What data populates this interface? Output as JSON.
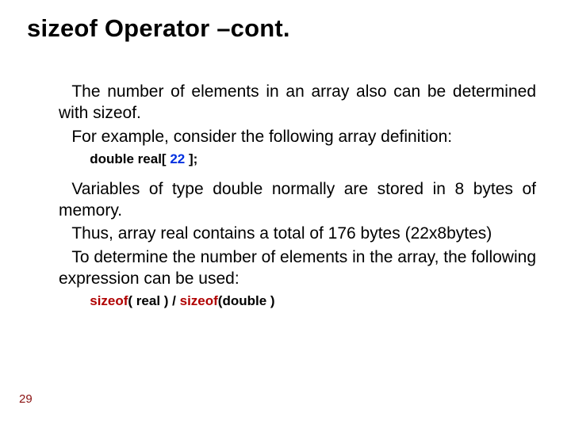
{
  "title": "sizeof Operator –cont.",
  "bullet_glyph": "",
  "bullets": {
    "b1": "The number of elements in an array also can be determined with sizeof.",
    "b2": "For example, consider the following array definition:",
    "b3": "Variables of type double normally are stored in 8 bytes of memory.",
    "b4": "Thus, array real contains a total of 176 bytes (22x8bytes)",
    "b5": "To determine the number of elements in the array, the following expression can be used:"
  },
  "code1": {
    "t1": "double real[ ",
    "lit": "22",
    "t2": " ];"
  },
  "code2": {
    "kw1": "sizeof",
    "t1": "( real ) / ",
    "kw2": "sizeof",
    "t2": "(double )"
  },
  "page_number": "29"
}
